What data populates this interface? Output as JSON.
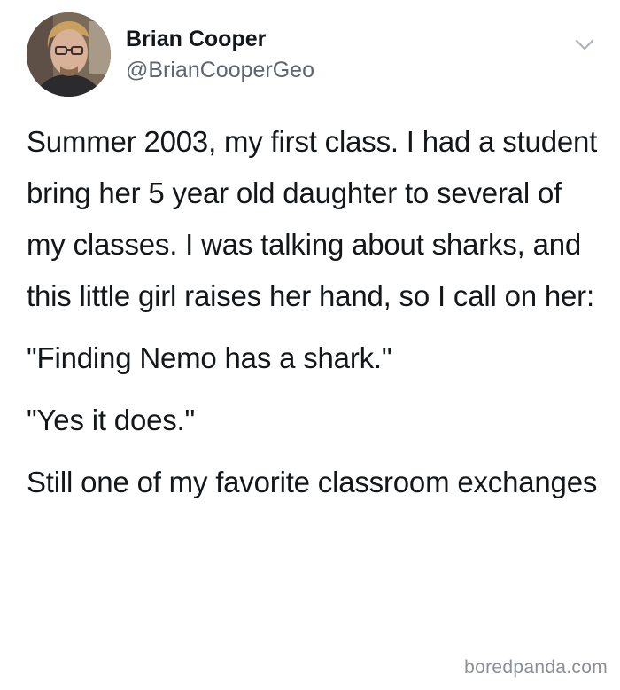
{
  "author": {
    "name": "Brian Cooper",
    "handle": "@BrianCooperGeo",
    "avatar_icon": "profile-photo"
  },
  "menu": {
    "icon": "chevron-down-icon"
  },
  "tweet": {
    "paragraphs": [
      "Summer 2003, my first class. I had a student bring her 5 year old daughter to several of my classes. I was talking about sharks, and this little girl raises her hand, so I call on her:",
      "\"Finding Nemo has a shark.\"",
      "\"Yes it does.\"",
      "Still one of my favorite classroom exchanges"
    ]
  },
  "watermark": {
    "text": "boredpanda.com"
  },
  "colors": {
    "text": "#14171a",
    "secondary": "#5b6670",
    "watermark": "#8b8f94",
    "background": "#ffffff"
  }
}
